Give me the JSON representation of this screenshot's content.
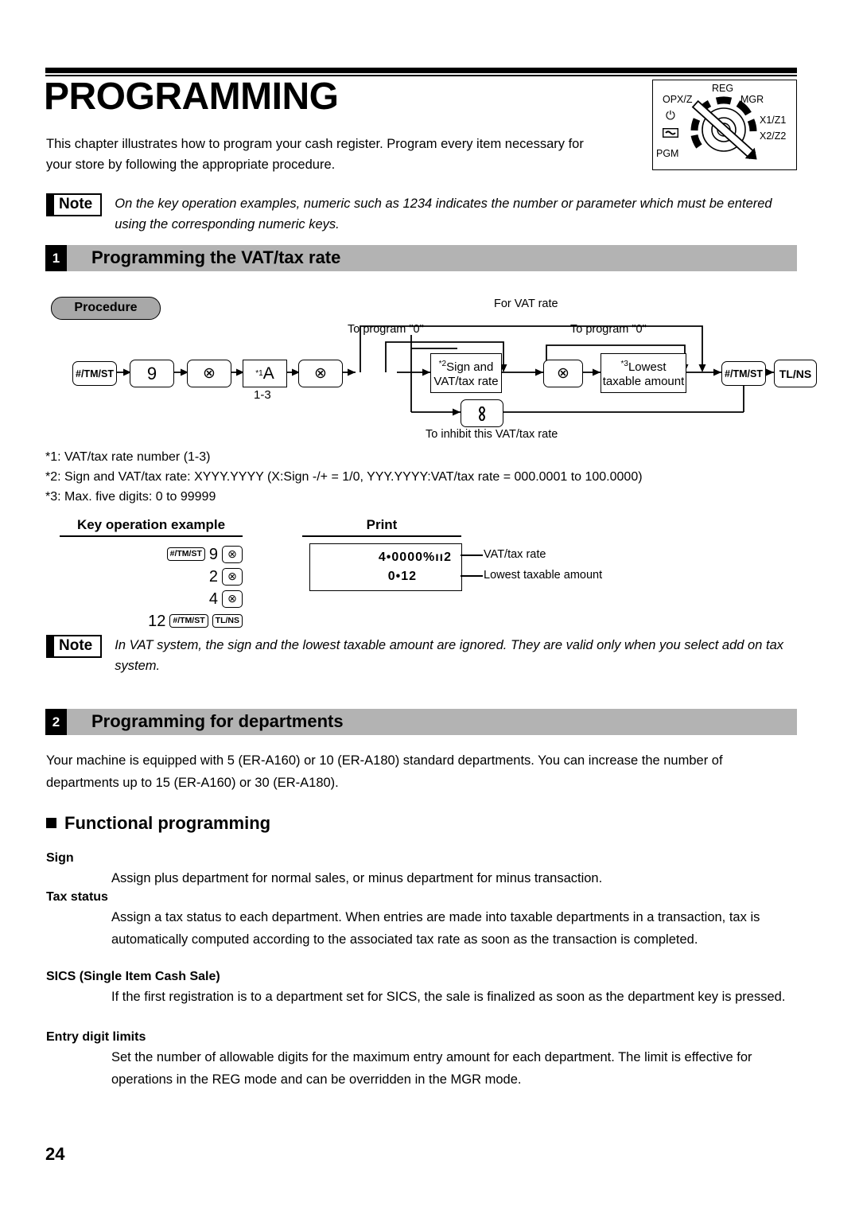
{
  "chapter": {
    "title": "PROGRAMMING",
    "intro": "This chapter illustrates how to program your cash register.  Program every item necessary for your store by following the appropriate procedure."
  },
  "mode_dial": {
    "labels": {
      "reg": "REG",
      "opxz": "OPX/Z",
      "mgr": "MGR",
      "x1z1": "X1/Z1",
      "x2z2": "X2/Z2",
      "pgm": "PGM"
    },
    "power_icon": "power-icon",
    "lock_icon": "key-lock-icon",
    "selected": "PGM"
  },
  "note1": {
    "badge": "Note",
    "text": "On the key operation examples, numeric such as 1234 indicates the number or parameter which must be entered using the corresponding numeric keys."
  },
  "section1": {
    "number": "1",
    "title": "Programming the VAT/tax rate"
  },
  "procedure": {
    "label": "Procedure",
    "keys": {
      "tmst": "#/TM/ST",
      "nine": "9",
      "multiply": "⊗",
      "a_param": "A",
      "a_sup": "*1",
      "a_range": "1-3",
      "ca": "ca-key-icon",
      "tlns": "TL/NS"
    },
    "boxes": {
      "sign_rate_sup": "*2",
      "sign_rate": "Sign and VAT/tax rate",
      "lowest_sup": "*3",
      "lowest": "Lowest taxable amount"
    },
    "labels": {
      "for_vat_rate": "For VAT rate",
      "to_program_zero_left": "To program \"0\"",
      "to_program_zero_right": "To program \"0\"",
      "inhibit": "To inhibit this VAT/tax rate"
    }
  },
  "footnotes": [
    "*1:  VAT/tax rate number (1-3)",
    "*2:  Sign and VAT/tax rate: XYYY.YYYY (X:Sign -/+ = 1/0, YYY.YYYY:VAT/tax rate = 000.0001 to 100.0000)",
    "*3:  Max. five digits: 0 to 99999"
  ],
  "example": {
    "key_head": "Key operation example",
    "print_head": "Print",
    "rows": [
      {
        "keys": [
          "#/TM/ST"
        ],
        "num": "9",
        "tail": "⊗"
      },
      {
        "keys": [],
        "num": "2",
        "tail": "⊗"
      },
      {
        "keys": [],
        "num": "4",
        "tail": "⊗"
      },
      {
        "keys": [
          "#/TM/ST",
          "TL/NS"
        ],
        "num": "12",
        "tail": ""
      }
    ],
    "print": {
      "line1": "4•0000%ıı2",
      "line2": "0•12",
      "callout1": "VAT/tax rate",
      "callout2": "Lowest taxable amount"
    }
  },
  "note2": {
    "badge": "Note",
    "text": "In VAT system, the sign and the lowest taxable amount are ignored.  They are valid only when you select add on tax system."
  },
  "section2": {
    "number": "2",
    "title": "Programming for departments",
    "intro": "Your machine is equipped with 5 (ER-A160) or 10 (ER-A180) standard departments.  You can increase the number of departments up to 15 (ER-A160) or 30 (ER-A180)."
  },
  "functional": {
    "heading": "Functional programming",
    "items": [
      {
        "head": "Sign",
        "body": "Assign plus department for normal sales, or minus department for minus transaction."
      },
      {
        "head": "Tax status",
        "body": "Assign a tax status to each department. When entries are made into taxable departments in a transaction, tax is automatically computed according to the associated tax rate as soon as the transaction is completed."
      },
      {
        "head": "SICS (Single Item Cash Sale)",
        "body": "If the first registration is to a department set for SICS, the sale is finalized as soon as the department key is pressed."
      },
      {
        "head": "Entry digit limits",
        "body": "Set the number of allowable digits for the maximum entry amount for each department.  The limit is effective for operations in the REG mode and can be overridden in the MGR mode."
      }
    ]
  },
  "page_number": "24"
}
